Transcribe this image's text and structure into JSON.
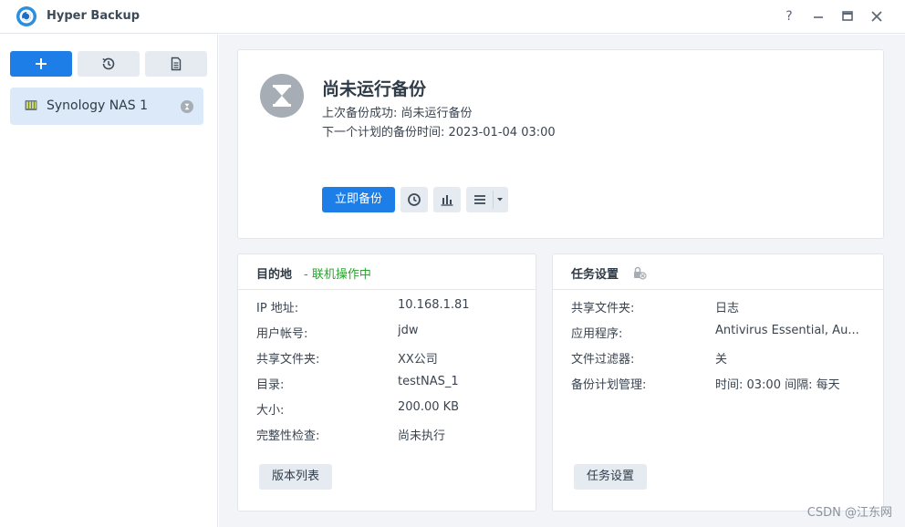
{
  "window": {
    "title": "Hyper Backup",
    "controls": [
      "help-icon",
      "minimize-icon",
      "maximize-icon",
      "close-icon"
    ],
    "help_label": "?"
  },
  "sidebar": {
    "buttons": [
      "add-icon",
      "history-icon",
      "log-icon"
    ],
    "tasks": [
      {
        "label": "Synology NAS 1",
        "icon": "nas-icon",
        "status_icon": "pending-icon"
      }
    ]
  },
  "status": {
    "title": "尚未运行备份",
    "last_success": "上次备份成功: 尚未运行备份",
    "next_scheduled": "下一个计划的备份时间: 2023-01-04 03:00",
    "icon": "hourglass-icon",
    "backup_now_label": "立即备份",
    "tools": [
      "clock-icon",
      "chart-icon",
      "menu-icon"
    ]
  },
  "destination": {
    "title": "目的地",
    "status": "- 联机操作中",
    "rows": [
      {
        "key": "IP 地址:",
        "value": "10.168.1.81"
      },
      {
        "key": "用户帐号:",
        "value": "jdw"
      },
      {
        "key": "共享文件夹:",
        "value": "XX公司"
      },
      {
        "key": "目录:",
        "value": "testNAS_1"
      },
      {
        "key": "大小:",
        "value": "200.00 KB"
      },
      {
        "key": "完整性检查:",
        "value": "尚未执行"
      }
    ],
    "button_label": "版本列表"
  },
  "task_settings": {
    "title": "任务设置",
    "icon": "encryption-lock-icon",
    "rows": [
      {
        "key": "共享文件夹:",
        "value": "日志"
      },
      {
        "key": "应用程序:",
        "value": "Antivirus Essential, Au..."
      },
      {
        "key": "文件过滤器:",
        "value": "关"
      },
      {
        "key": "备份计划管理:",
        "value": "时间: 03:00 间隔: 每天"
      }
    ],
    "button_label": "任务设置"
  },
  "watermark": "CSDN @江东网",
  "colors": {
    "accent": "#1d7ee8",
    "online": "#2aa12f",
    "sidebar_selected": "#dbe9f8",
    "status_circle": "#a6adb5"
  }
}
